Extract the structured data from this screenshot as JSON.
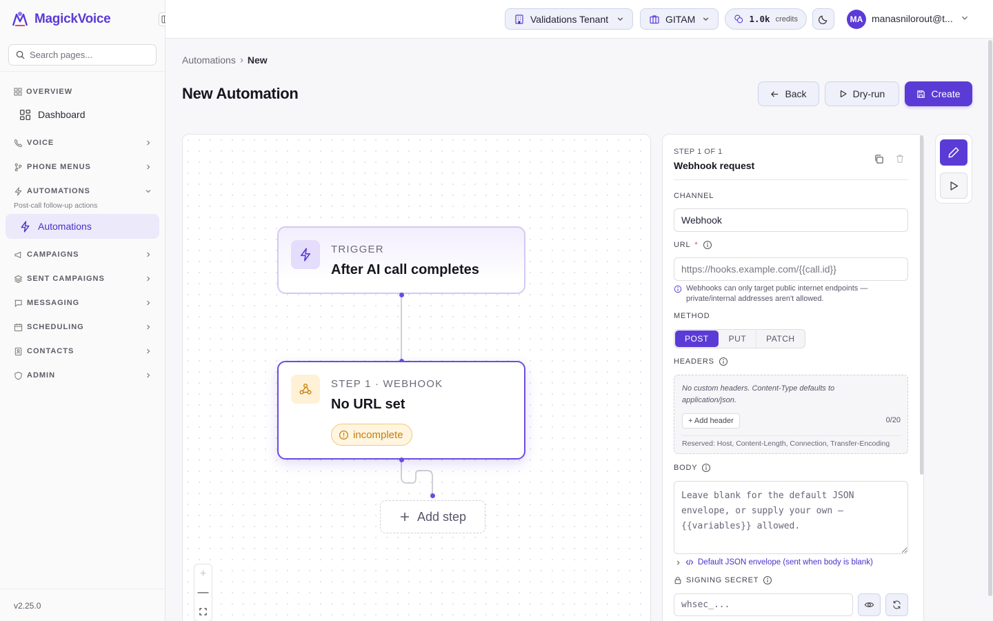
{
  "app": {
    "name": "MagickVoice",
    "version": "v2.25.0"
  },
  "search": {
    "placeholder": "Search pages..."
  },
  "sidebar": {
    "overview_label": "OVERVIEW",
    "dashboard_label": "Dashboard",
    "groups": [
      {
        "label": "VOICE",
        "icon": "phone-icon"
      },
      {
        "label": "PHONE MENUS",
        "icon": "branch-icon"
      },
      {
        "label": "AUTOMATIONS",
        "icon": "lightning-icon",
        "expanded": true,
        "subtitle": "Post-call follow-up actions"
      },
      {
        "label": "CAMPAIGNS",
        "icon": "megaphone-icon"
      },
      {
        "label": "SENT CAMPAIGNS",
        "icon": "layers-icon"
      },
      {
        "label": "MESSAGING",
        "icon": "chat-icon"
      },
      {
        "label": "SCHEDULING",
        "icon": "calendar-icon"
      },
      {
        "label": "CONTACTS",
        "icon": "contact-book-icon"
      },
      {
        "label": "ADMIN",
        "icon": "shield-icon"
      }
    ],
    "active_item": "Automations"
  },
  "topbar": {
    "tenant": "Validations Tenant",
    "org": "GITAM",
    "credits_value": "1.0k",
    "credits_label": "credits",
    "avatar_initials": "MA",
    "user_email": "manasnilorout@t..."
  },
  "breadcrumb": {
    "parent": "Automations",
    "current": "New"
  },
  "page": {
    "title": "New Automation",
    "back_label": "Back",
    "dryrun_label": "Dry-run",
    "create_label": "Create"
  },
  "flow": {
    "trigger": {
      "kicker": "TRIGGER",
      "title": "After AI call completes"
    },
    "step": {
      "kicker": "STEP 1 · WEBHOOK",
      "title": "No URL set",
      "status": "incomplete"
    },
    "add_step_label": "Add step",
    "zoom_in": "+",
    "zoom_out": "—"
  },
  "panel": {
    "step_counter": "STEP 1 OF 1",
    "title": "Webhook request",
    "channel_label": "CHANNEL",
    "channel_value": "Webhook",
    "url_label": "URL",
    "url_required": "*",
    "url_placeholder": "https://hooks.example.com/{{call.id}}",
    "url_hint": "Webhooks can only target public internet endpoints — private/internal addresses aren't allowed.",
    "method_label": "METHOD",
    "methods": [
      "POST",
      "PUT",
      "PATCH"
    ],
    "method_selected": "POST",
    "headers_label": "HEADERS",
    "headers_empty": "No custom headers. Content-Type defaults to application/json.",
    "add_header_label": "+ Add header",
    "headers_count": "0/20",
    "headers_reserved": "Reserved: Host, Content-Length, Connection, Transfer-Encoding",
    "body_label": "BODY",
    "body_placeholder": "Leave blank for the default JSON envelope, or supply your own — {{variables}} allowed.",
    "envelope_label": "Default JSON envelope (sent when body is blank)",
    "secret_label": "SIGNING SECRET",
    "secret_placeholder": "whsec_..."
  },
  "colors": {
    "accent": "#5b3bd6",
    "warning": "#c77d08",
    "node_border": "#6a4ce0"
  }
}
